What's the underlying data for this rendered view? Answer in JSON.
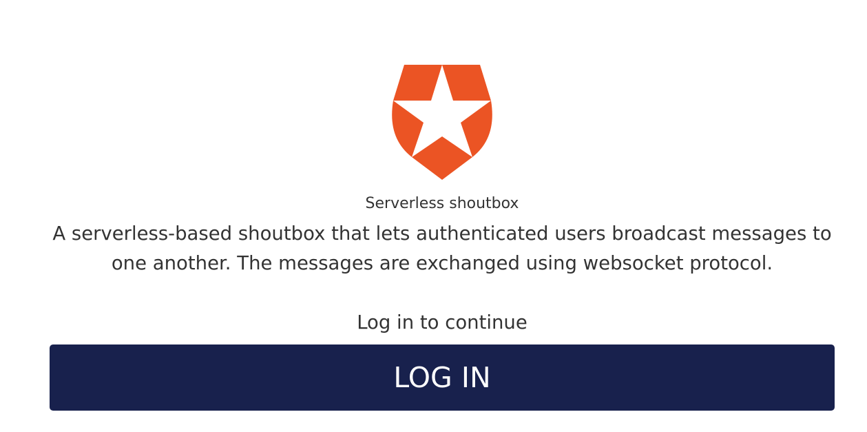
{
  "logo": {
    "icon": "auth0-shield-star-icon",
    "color": "#eb5424"
  },
  "app": {
    "title": "Serverless shoutbox",
    "description": "A serverless-based shoutbox that lets authenticated users broadcast messages to one another. The messages are exchanged using websocket protocol.",
    "prompt": "Log in to continue"
  },
  "login_button": {
    "label": "LOG IN",
    "color": "#18214d"
  }
}
